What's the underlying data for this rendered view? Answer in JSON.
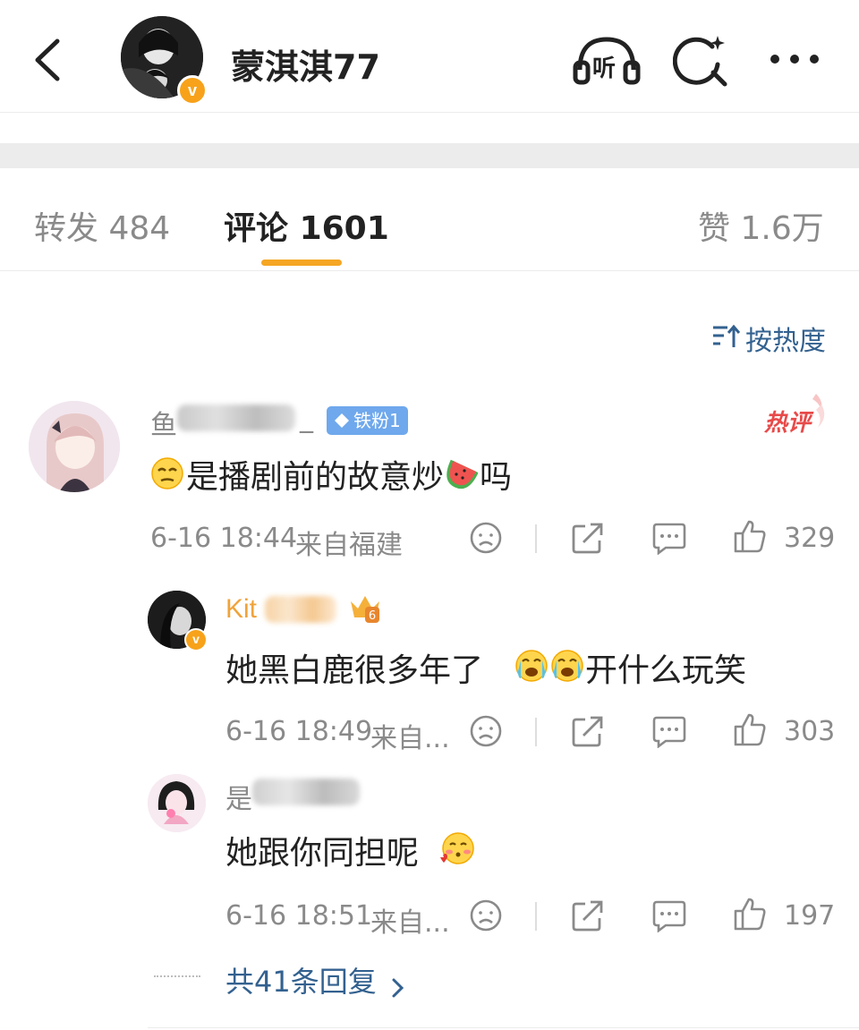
{
  "header": {
    "back_icon": "chevron-left-icon",
    "username": "蒙淇淇77",
    "listen_label": "听",
    "colors": {
      "verified_badge": "#f7a21a",
      "accent": "#f5a623",
      "link": "#33618f"
    }
  },
  "tabs": {
    "repost": {
      "label": "转发",
      "count": "484"
    },
    "comment": {
      "label": "评论",
      "count": "1601"
    },
    "like": {
      "label": "赞",
      "count": "1.6万"
    }
  },
  "sort": {
    "label": "按热度",
    "icon": "sort-icon"
  },
  "comment": {
    "nickname_visible": "鱼",
    "nickname_tail": "_",
    "fan_badge": "铁粉1",
    "hot_tag": "热评",
    "text": "是播剧前的故意炒",
    "text_end": "吗",
    "time": "6-16 18:44",
    "location": "来自福建",
    "likes": "329"
  },
  "replies": [
    {
      "nickname_visible": "Kit",
      "text": "她黑白鹿很多年了",
      "text_end": "开什么玩笑",
      "time": "6-16 18:49",
      "location": "来自...",
      "likes": "303"
    },
    {
      "nickname_visible": "是",
      "text": "她跟你同担呢",
      "time": "6-16 18:51",
      "location": "来自...",
      "likes": "197"
    }
  ],
  "more_replies": {
    "label": "共41条回复"
  }
}
